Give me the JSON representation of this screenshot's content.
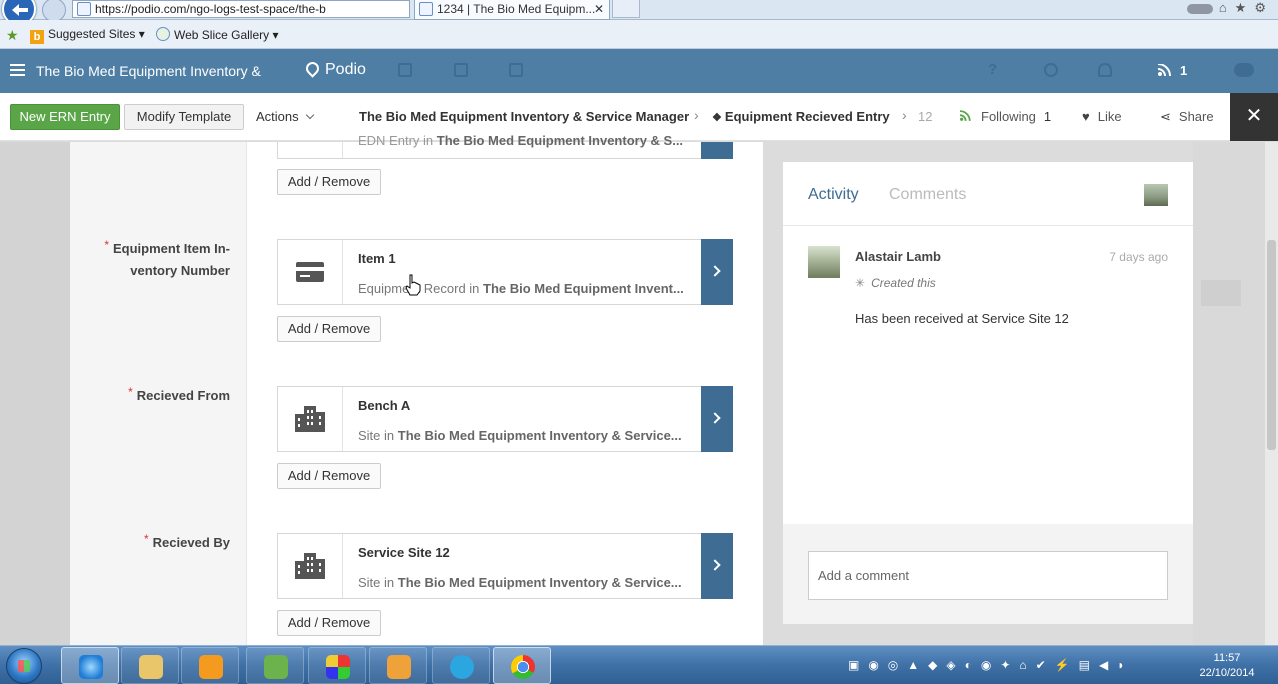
{
  "browser": {
    "url": "https://podio.com/ngo-logs-test-space/the-b",
    "tab_title": "1234 | The Bio Med Equipm...",
    "tab_close": "✕",
    "right_icons": "⌂★⚙",
    "favorites": [
      {
        "label": "Suggested Sites ▾"
      },
      {
        "label": "Web Slice Gallery ▾"
      }
    ]
  },
  "podio_nav": {
    "workspace": "The Bio Med Equipment Inventory &",
    "logo": "Podio",
    "notifications_count": "1"
  },
  "toolbar": {
    "new_entry": "New ERN Entry",
    "modify_template": "Modify Template",
    "actions": "Actions",
    "breadcrumb_app": "The Bio Med Equipment Inventory & Service Manager",
    "breadcrumb_item": "Equipment Recieved Entry",
    "breadcrumb_id": "12",
    "following": "Following",
    "following_count": "1",
    "like": "Like",
    "share": "Share",
    "close": "✕"
  },
  "form": {
    "top_partial": {
      "subtitle_prefix": "EDN Entry in ",
      "subtitle_app": "The Bio Med Equipment Inventory & S..."
    },
    "add_remove": "Add / Remove",
    "fields": [
      {
        "label": "Equipment Item In-ventory Number",
        "ref_title": "Item 1",
        "ref_sub_prefix": "Equipment Record in ",
        "ref_sub_app": "The Bio Med Equipment Invent...",
        "icon": "card-icon"
      },
      {
        "label": "Recieved From",
        "ref_title": "Bench A",
        "ref_sub_prefix": "Site in ",
        "ref_sub_app": "The Bio Med Equipment Inventory & Service...",
        "icon": "building-icon"
      },
      {
        "label": "Recieved By",
        "ref_title": "Service Site 12",
        "ref_sub_prefix": "Site in ",
        "ref_sub_app": "The Bio Med Equipment Inventory & Service...",
        "icon": "building-icon"
      }
    ]
  },
  "activity": {
    "tab_activity": "Activity",
    "tab_comments": "Comments",
    "user": "Alastair Lamb",
    "time": "7 days ago",
    "created": "Created this",
    "message": "Has been received at Service Site 12",
    "comment_placeholder": "Add a comment"
  },
  "taskbar": {
    "time": "11:57",
    "date": "22/10/2014"
  },
  "colors": {
    "podio_blue": "#4f7ea4",
    "accent_dark_blue": "#3f6c92",
    "new_button_green": "#59a548"
  }
}
